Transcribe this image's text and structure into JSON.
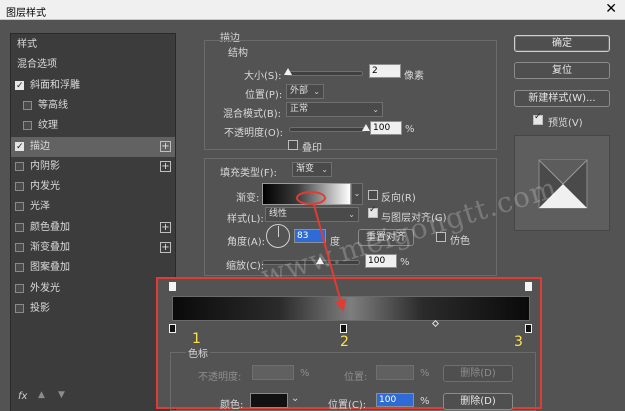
{
  "window": {
    "title": "图层样式",
    "close_glyph": "✕"
  },
  "sidebar": {
    "items": [
      {
        "label": "样式",
        "checkbox": false,
        "indent": false,
        "selected": false,
        "plus": false
      },
      {
        "label": "混合选项",
        "checkbox": false,
        "indent": false,
        "selected": false,
        "plus": false
      },
      {
        "label": "斜面和浮雕",
        "checkbox": true,
        "checked": true,
        "indent": false,
        "selected": false,
        "plus": false
      },
      {
        "label": "等高线",
        "checkbox": true,
        "checked": false,
        "indent": true,
        "selected": false,
        "plus": false
      },
      {
        "label": "纹理",
        "checkbox": true,
        "checked": false,
        "indent": true,
        "selected": false,
        "plus": false
      },
      {
        "label": "描边",
        "checkbox": true,
        "checked": true,
        "indent": false,
        "selected": true,
        "plus": true
      },
      {
        "label": "内阴影",
        "checkbox": true,
        "checked": false,
        "indent": false,
        "selected": false,
        "plus": true
      },
      {
        "label": "内发光",
        "checkbox": true,
        "checked": false,
        "indent": false,
        "selected": false,
        "plus": false
      },
      {
        "label": "光泽",
        "checkbox": true,
        "checked": false,
        "indent": false,
        "selected": false,
        "plus": false
      },
      {
        "label": "颜色叠加",
        "checkbox": true,
        "checked": false,
        "indent": false,
        "selected": false,
        "plus": true
      },
      {
        "label": "渐变叠加",
        "checkbox": true,
        "checked": false,
        "indent": false,
        "selected": false,
        "plus": true
      },
      {
        "label": "图案叠加",
        "checkbox": true,
        "checked": false,
        "indent": false,
        "selected": false,
        "plus": false
      },
      {
        "label": "外发光",
        "checkbox": true,
        "checked": false,
        "indent": false,
        "selected": false,
        "plus": false
      },
      {
        "label": "投影",
        "checkbox": true,
        "checked": false,
        "indent": false,
        "selected": false,
        "plus": true
      }
    ],
    "plus_glyph": "+",
    "fx_label": "fx",
    "up_glyph": "▲",
    "down_glyph": "▼"
  },
  "stroke": {
    "section_title": "描边",
    "structure_title": "结构",
    "size_label": "大小(S):",
    "size_value": "2",
    "size_unit": "像素",
    "size_slider_fraction": 0.02,
    "position_label": "位置(P):",
    "position_value": "外部",
    "blend_label": "混合模式(B):",
    "blend_value": "正常",
    "opacity_label": "不透明度(O):",
    "opacity_value": "100",
    "opacity_unit": "%",
    "opacity_slider_fraction": 1.0,
    "overprint_label": "叠印",
    "fill_type_label": "填充类型(F):",
    "fill_type_value": "渐变",
    "gradient_label": "渐变:",
    "reverse_label": "反向(R)",
    "style_label": "样式(L):",
    "style_value": "线性",
    "align_label": "与图层对齐(G)",
    "angle_label": "角度(A):",
    "angle_value": "83",
    "angle_unit": "度",
    "reset_align_label": "重置对齐",
    "dither_label": "仿色",
    "scale_label": "缩放(C):",
    "scale_value": "100",
    "scale_unit": "%"
  },
  "buttons": {
    "ok": "确定",
    "reset": "复位",
    "new_style": "新建样式(W)...",
    "preview_label": "预览(V)"
  },
  "gradient_editor": {
    "stops_title": "色标",
    "opacity_label": "不透明度:",
    "opacity_unit": "%",
    "location_label": "位置:",
    "location_unit": "%",
    "delete_label": "删除(D)",
    "color_label": "颜色:",
    "color_location_label": "位置(C):",
    "color_location_value": "100",
    "color_location_unit": "%",
    "color_delete_label": "删除(D)",
    "chevron_glyph": "⌄",
    "markers": [
      "1",
      "2",
      "3"
    ]
  },
  "watermark": "www.meigongtt.com",
  "colors": {
    "panel_bg": "#535353",
    "list_bg": "#3c3c3c",
    "selected_item": "#626262",
    "highlight_red": "#e23b33",
    "marker_yellow": "#ffe24a",
    "input_highlight": "#2f6bd6"
  }
}
